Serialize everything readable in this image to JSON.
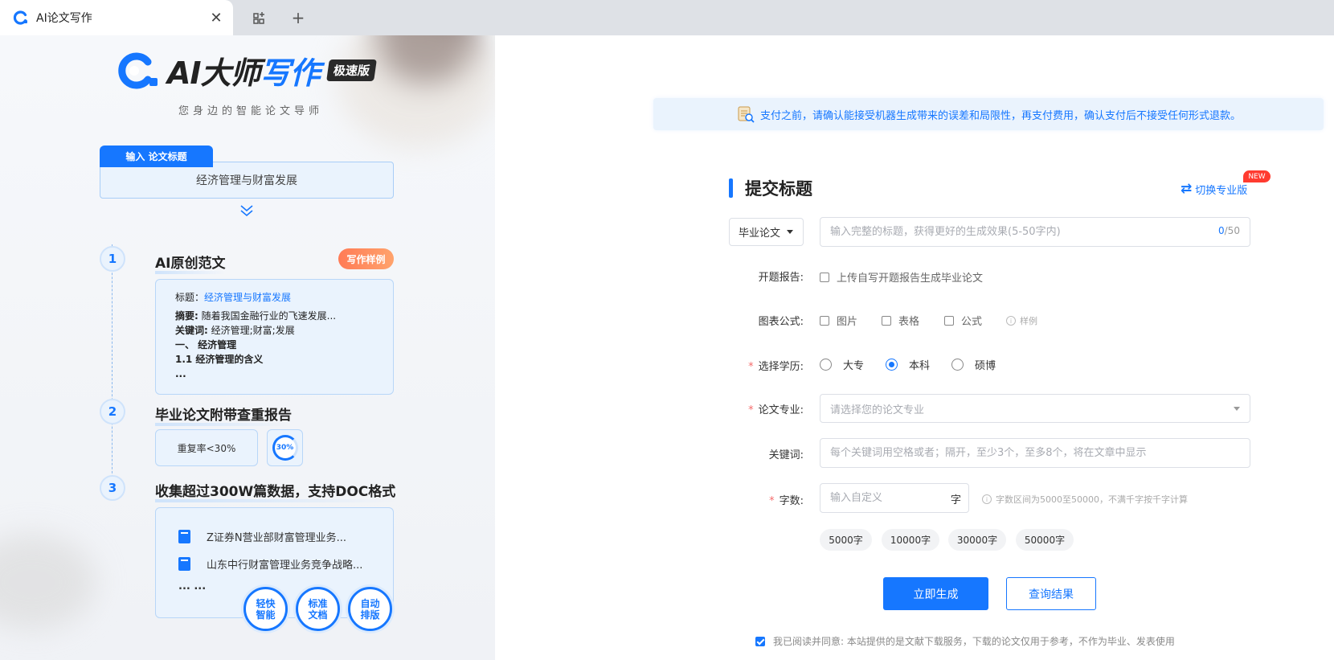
{
  "browser": {
    "tab_title": "AI论文写作",
    "close_glyph": "✕",
    "new_tab_glyph": "+"
  },
  "brand": {
    "logo_ai": "AI大师",
    "logo_write": "写作",
    "badge": "极速版",
    "slogan": "您身边的智能论文导师",
    "accent_color": "#1677ff"
  },
  "left": {
    "input_tag": "输入 论文标题",
    "input_title_value": "经济管理与财富发展",
    "steps": [
      {
        "num": "1",
        "title": "AI原创范文"
      },
      {
        "num": "2",
        "title": "毕业论文附带查重报告"
      },
      {
        "num": "3",
        "title": "收集超过300W篇数据，支持DOC格式"
      }
    ],
    "sample_badge": "写作样例",
    "sample": {
      "title_key": "标题：",
      "title_value": "经济管理与财富发展",
      "abstract_key": "摘要:",
      "abstract_value": " 随着我国金融行业的飞速发展...",
      "keywords_key": "关键词:",
      "keywords_value": " 经济管理;财富;发展",
      "h1": "一、 经济管理",
      "h2": "1.1 经济管理的含义",
      "more": "..."
    },
    "dup_rate": "重复率<30%",
    "dup_ring": "30%",
    "docs": [
      "Z证券N营业部财富管理业务...",
      "山东中行财富管理业务竞争战略..."
    ],
    "docs_more": "... ...",
    "features": [
      "轻快智能",
      "标准文档",
      "自动排版"
    ]
  },
  "notice": "支付之前，请确认能接受机器生成带来的误差和局限性，再支付费用，确认支付后不接受任何形式退款。",
  "form": {
    "section_title": "提交标题",
    "switch_label": "切换专业版",
    "new_badge": "NEW",
    "type_select": "毕业论文",
    "title_placeholder": "输入完整的标题，获得更好的生成效果(5-50字内)",
    "counter_current": "0",
    "counter_max": "/50",
    "proposal_label": "开题报告:",
    "proposal_checkbox": "上传自写开题报告生成毕业论文",
    "chart_label": "图表公式:",
    "chart_options": [
      "图片",
      "表格",
      "公式"
    ],
    "chart_hint": "样例",
    "degree_label": "选择学历:",
    "degree_options": [
      "大专",
      "本科",
      "硕博"
    ],
    "degree_selected": "本科",
    "major_label": "论文专业:",
    "major_placeholder": "请选择您的论文专业",
    "keywords_label": "关键词:",
    "keywords_placeholder": "每个关键词用空格或者；隔开，至少3个，至多8个，将在文章中显示",
    "words_label": "字数:",
    "words_placeholder": "输入自定义",
    "words_unit": "字",
    "words_hint": "字数区间为5000至50000，不满千字按千字计算",
    "word_chips": [
      "5000字",
      "10000字",
      "30000字",
      "50000字"
    ],
    "generate_button": "立即生成",
    "query_button": "查询结果",
    "agree_text": "我已阅读并同意: 本站提供的是文献下载服务，下载的论文仅用于参考，不作为毕业、发表使用",
    "required_mark": "*",
    "info_glyph": "i"
  }
}
